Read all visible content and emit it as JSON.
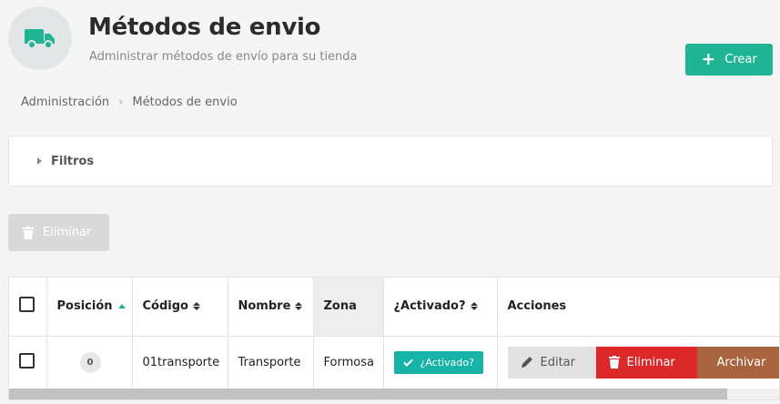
{
  "header": {
    "title": "Métodos de envio",
    "subtitle": "Administrar métodos de envío para su tienda",
    "icon": "truck-icon",
    "create_label": "Crear"
  },
  "breadcrumb": {
    "items": [
      "Administración",
      "Métodos de envio"
    ]
  },
  "filters": {
    "label": "Filtros"
  },
  "bulk_delete_label": "Eliminar",
  "table": {
    "columns": {
      "posicion": "Posición",
      "codigo": "Código",
      "nombre": "Nombre",
      "zona": "Zona",
      "activado": "¿Activado?",
      "acciones": "Acciones"
    },
    "rows": [
      {
        "posicion": "0",
        "codigo": "01transporte",
        "nombre": "Transporte",
        "zona": "Formosa",
        "activado": "¿Activado?",
        "actions": {
          "edit": "Editar",
          "delete": "Eliminar",
          "archive": "Archivar"
        }
      }
    ]
  },
  "colors": {
    "accent": "#1fb594",
    "active_badge": "#17b3a6",
    "delete": "#dc2828",
    "archive": "#a8643f"
  }
}
